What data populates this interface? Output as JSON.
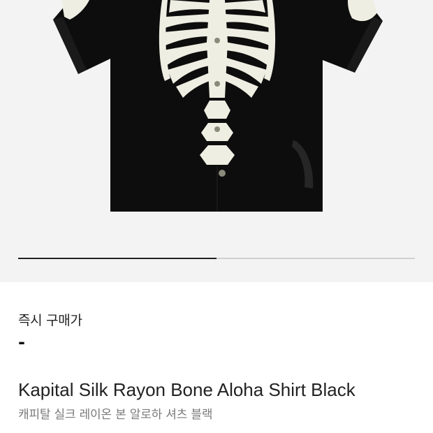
{
  "gallery": {
    "image_subject": "Black short-sleeve aloha shirt with white skeleton bone print",
    "pagination_progress": 0.5
  },
  "price": {
    "label": "즉시 구매가",
    "value": "-"
  },
  "product": {
    "name_en": "Kapital Silk Rayon Bone Aloha Shirt Black",
    "name_ko": "캐피탈 실크 레이온 본 알로하 셔츠 블랙"
  },
  "colors": {
    "gallery_bg": "#f3f3f3",
    "shirt": "#0d0d0d",
    "bone": "#efeee2",
    "progress_active": "#222222",
    "progress_track": "#d0d0d0",
    "subtitle": "#7a7a7a"
  }
}
